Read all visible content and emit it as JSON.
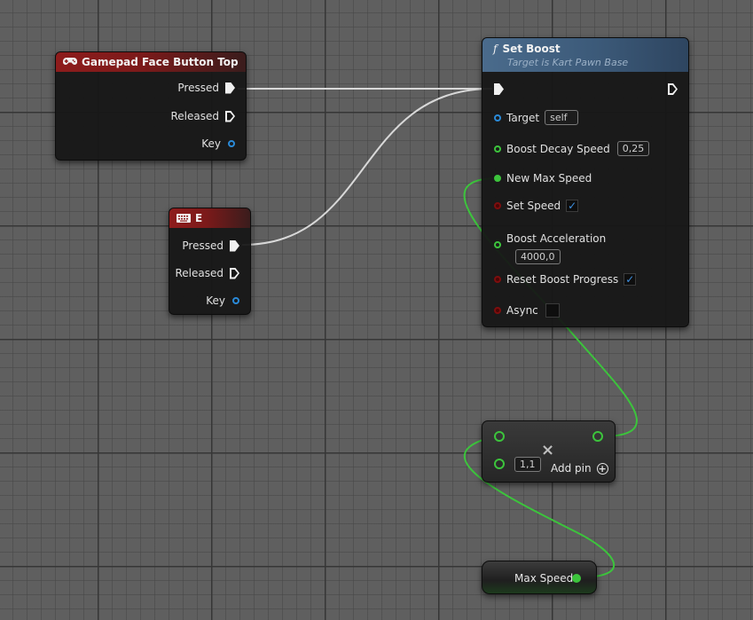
{
  "gamepad_node": {
    "title": "Gamepad Face Button Top",
    "pins": {
      "pressed": "Pressed",
      "released": "Released",
      "key": "Key"
    }
  },
  "e_node": {
    "title": "E",
    "pins": {
      "pressed": "Pressed",
      "released": "Released",
      "key": "Key"
    }
  },
  "set_boost_node": {
    "icon": "f",
    "title": "Set Boost",
    "subtitle": "Target is Kart Pawn Base",
    "pins": {
      "target": "Target",
      "target_value": "self",
      "boost_decay_speed": "Boost Decay Speed",
      "boost_decay_speed_value": "0,25",
      "new_max_speed": "New Max Speed",
      "set_speed": "Set Speed",
      "set_speed_checked": true,
      "boost_acceleration": "Boost Acceleration",
      "boost_acceleration_value": "4000,0",
      "reset_boost_progress": "Reset Boost Progress",
      "reset_boost_progress_checked": true,
      "async": "Async",
      "async_checked": false
    }
  },
  "multiply_node": {
    "operator": "×",
    "input_value": "1,1",
    "add_pin_label": "Add pin",
    "add_pin_icon": "+"
  },
  "max_speed_node": {
    "label": "Max Speed"
  },
  "colors": {
    "exec_wire": "#d8d8d8",
    "float_wire": "#3cc43c",
    "event_header": "#8e1c1c",
    "function_header": "#4a6b8c"
  }
}
